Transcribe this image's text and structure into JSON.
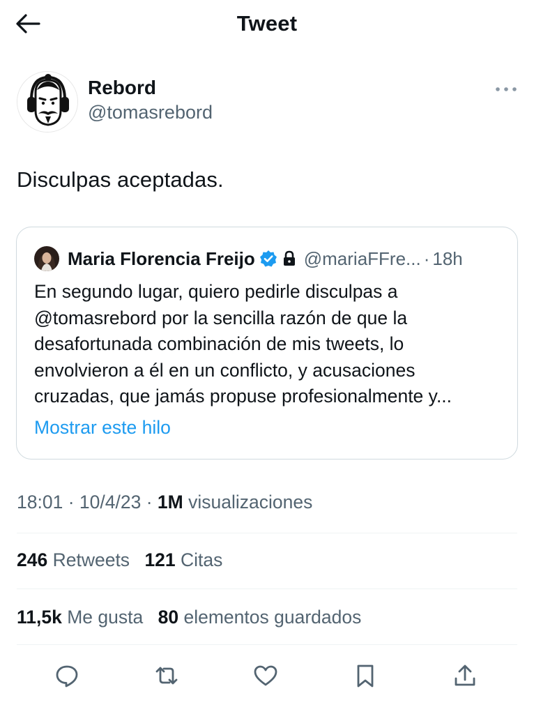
{
  "header": {
    "title": "Tweet",
    "back_icon": "arrow-left-icon"
  },
  "author": {
    "name": "Rebord",
    "handle": "@tomasrebord",
    "avatar_icon": "cartoon-face-avatar",
    "more_icon": "more-dots-icon"
  },
  "tweet": {
    "text": "Disculpas aceptadas."
  },
  "quote": {
    "name": "Maria Florencia Freijo",
    "handle": "@mariaFFre...",
    "separator": "·",
    "time": "18h",
    "verified_icon": "verified-badge-icon",
    "lock_icon": "lock-icon",
    "body_lines": [
      "En segundo lugar, quiero pedirle disculpas a",
      "@tomasrebord por la sencilla razón de que la",
      "desafortunada combinación de mis tweets, lo",
      "envolvieron a él en un conflicto, y acusaciones",
      "cruzadas, que jamás propuse profesionalmente y..."
    ],
    "show_thread": "Mostrar este hilo"
  },
  "meta": {
    "time": "18:01",
    "sep1": "·",
    "date": "10/4/23",
    "sep2": "·",
    "views_count": "1M",
    "views_label": "visualizaciones"
  },
  "stats": {
    "retweets_count": "246",
    "retweets_label": "Retweets",
    "quotes_count": "121",
    "quotes_label": "Citas",
    "likes_count": "11,5k",
    "likes_label": "Me gusta",
    "bookmarks_count": "80",
    "bookmarks_label": "elementos guardados"
  },
  "actions": [
    "reply-icon",
    "retweet-icon",
    "like-icon",
    "bookmark-icon",
    "share-icon"
  ],
  "colors": {
    "text": "#0f1419",
    "secondary": "#536471",
    "link": "#1d9bf0",
    "border": "#cfd9de",
    "verified": "#1d9bf0"
  }
}
